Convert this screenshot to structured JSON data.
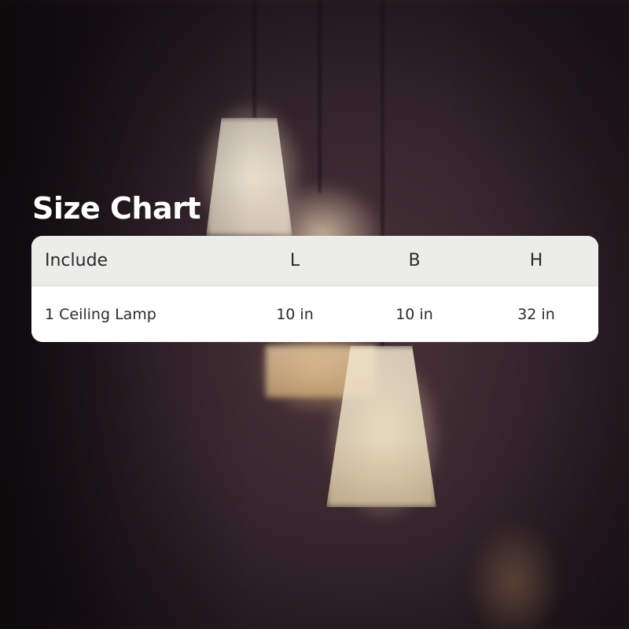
{
  "title": "Size Chart",
  "table": {
    "headers": [
      "Include",
      "L",
      "B",
      "H"
    ],
    "rows": [
      [
        "1 Ceiling Lamp",
        "10 in",
        "10 in",
        "32 in"
      ]
    ]
  }
}
